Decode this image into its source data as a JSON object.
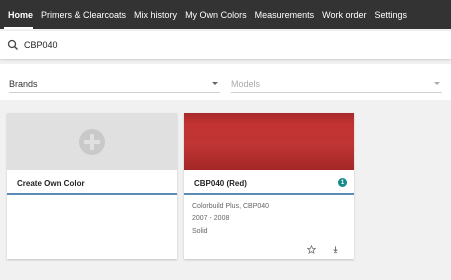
{
  "nav": {
    "items": [
      {
        "label": "Home",
        "active": true
      },
      {
        "label": "Primers & Clearcoats"
      },
      {
        "label": "Mix history"
      },
      {
        "label": "My Own Colors"
      },
      {
        "label": "Measurements"
      },
      {
        "label": "Work order"
      },
      {
        "label": "Settings"
      }
    ]
  },
  "search": {
    "value": "CBP040",
    "icon": "search-icon"
  },
  "filters": {
    "brands": {
      "label": "Brands"
    },
    "models": {
      "label": "Models"
    }
  },
  "cards": {
    "create": {
      "title": "Create Own Color",
      "icon": "plus-circle-icon"
    },
    "color": {
      "title": "CBP040 (Red)",
      "badge": "1",
      "line1": "Colorbuild Plus, CBP040",
      "line2": "2007 - 2008",
      "line3": "Solid",
      "swatch_color": "#c03535"
    }
  },
  "colors": {
    "nav_bg": "#333333",
    "accent": "#5b8bb5",
    "badge": "#178a8a"
  }
}
